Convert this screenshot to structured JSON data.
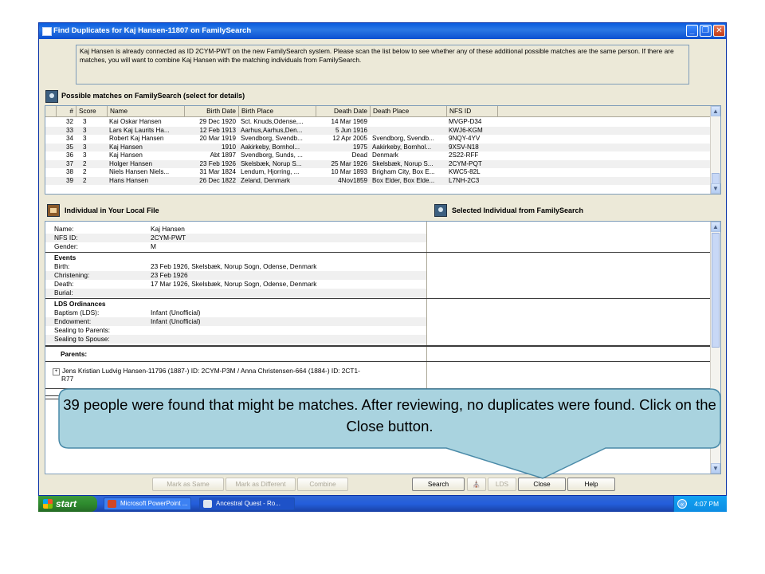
{
  "window": {
    "title": "Find Duplicates for Kaj Hansen-11807 on FamilySearch",
    "minimize": "_",
    "restore": "❐",
    "close": "✕"
  },
  "intro": "Kaj Hansen is already connected as ID 2CYM-PWT on the new FamilySearch system. Please scan the list below to see whether any of these additional possible matches are the same person. If there are matches, you will want to combine Kaj Hansen with the matching individuals from FamilySearch.",
  "matches": {
    "heading": "Possible matches on FamilySearch (select for details)",
    "columns": [
      "#",
      "Score",
      "Name",
      "Birth Date",
      "Birth Place",
      "Death Date",
      "Death Place",
      "NFS ID"
    ],
    "rows": [
      [
        "32",
        "3",
        "Kai Oskar Hansen",
        "29 Dec 1920",
        "Sct. Knuds,Odense,...",
        "14 Mar 1969",
        "",
        "MVGP-D34"
      ],
      [
        "33",
        "3",
        "Lars Kaj Laurits Ha...",
        "12 Feb 1913",
        "Aarhus,Aarhus,Den...",
        "5 Jun 1916",
        "",
        "KWJ6-KGM"
      ],
      [
        "34",
        "3",
        "Robert Kaj Hansen",
        "20 Mar 1919",
        "Svendborg, Svendb...",
        "12 Apr 2005",
        "Svendborg, Svendb...",
        "9NQY-4YV"
      ],
      [
        "35",
        "3",
        "Kaj Hansen",
        "1910",
        "Aakirkeby, Bornhol...",
        "1975",
        "Aakirkeby, Bornhol...",
        "9XSV-N18"
      ],
      [
        "36",
        "3",
        "Kaj Hansen",
        "Abt 1897",
        "Svendborg, Sunds, ...",
        "Dead",
        "Denmark",
        "2S22-RFF"
      ],
      [
        "37",
        "2",
        "Holger Hansen",
        "23 Feb 1926",
        "Skelsbæk, Norup S...",
        "25 Mar 1926",
        "Skelsbæk, Norup S...",
        "2CYM-PQT"
      ],
      [
        "38",
        "2",
        "Niels Hansen Niels...",
        "31 Mar 1824",
        "Lendum, Hjorring, ...",
        "10 Mar 1893",
        "Brigham City, Box E...",
        "KWC5-82L"
      ],
      [
        "39",
        "2",
        "Hans Hansen",
        "26 Dec 1822",
        "Zeland, Denmark",
        "4Nov1859",
        "Box Elder, Box Elde...",
        "L7NH-2C3"
      ]
    ]
  },
  "local": {
    "heading": "Individual in Your Local File",
    "fields": [
      {
        "label": "Name:",
        "value": "Kaj Hansen"
      },
      {
        "label": "NFS ID:",
        "value": "2CYM-PWT"
      },
      {
        "label": "Gender:",
        "value": "M"
      }
    ],
    "events_heading": "Events",
    "events": [
      {
        "label": "Birth:",
        "value": "23 Feb 1926, Skelsbæk, Norup Sogn, Odense, Denmark"
      },
      {
        "label": "Christening:",
        "value": "23 Feb 1926"
      },
      {
        "label": "Death:",
        "value": "17 Mar 1926, Skelsbæk, Norup Sogn, Odense, Denmark"
      },
      {
        "label": "Burial:",
        "value": ""
      }
    ],
    "ordinances_heading": "LDS Ordinances",
    "ordinances": [
      {
        "label": "Baptism (LDS):",
        "value": "Infant (Unofficial)"
      },
      {
        "label": "Endowment:",
        "value": "Infant (Unofficial)"
      },
      {
        "label": "Sealing to Parents:",
        "value": ""
      },
      {
        "label": "Sealing to Spouse:",
        "value": ""
      }
    ],
    "parents_heading": "Parents:",
    "parents_line1": "Jens Kristian Ludvig Hansen-11796 (1887-)  ID: 2CYM-P3M / Anna Christensen-664 (1884-)  ID: 2CT1-",
    "parents_line2": "R77"
  },
  "selected": {
    "heading": "Selected Individual from FamilySearch"
  },
  "buttons": {
    "mark_same": "Mark as Same",
    "mark_different": "Mark as Different",
    "combine": "Combine",
    "search": "Search",
    "lds": "LDS",
    "close": "Close",
    "help": "Help"
  },
  "taskbar": {
    "start": "start",
    "tasks": [
      "Microsoft PowerPoint ...",
      "Ancestral Quest - Ro..."
    ],
    "clock": "4:07 PM"
  },
  "callout": "39 people were found that might be matches.  After reviewing, no duplicates were found.  Click on the Close button.",
  "colors": {
    "callout_fill": "#a9d3df",
    "callout_border": "#4a8aa8",
    "titlebar": "#0a5ce0"
  }
}
